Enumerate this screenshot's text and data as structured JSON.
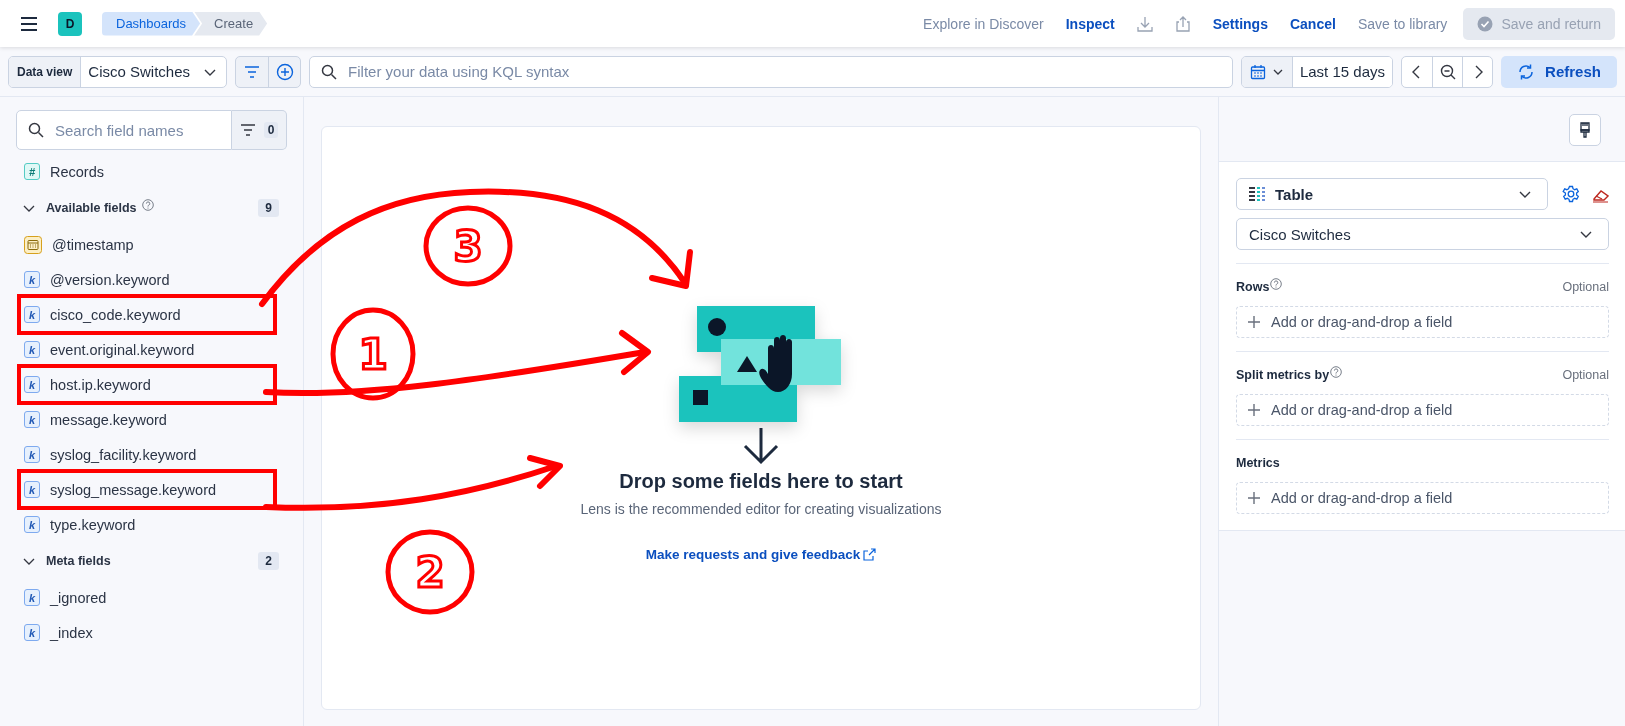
{
  "header": {
    "logo": "D",
    "breadcrumbs": [
      {
        "label": "Dashboards",
        "current": false
      },
      {
        "label": "Create",
        "current": true
      }
    ],
    "actions": [
      {
        "kind": "link",
        "label": "Explore in Discover",
        "disabled": true
      },
      {
        "kind": "link",
        "label": "Inspect",
        "disabled": false
      },
      {
        "kind": "download",
        "disabled": true
      },
      {
        "kind": "share",
        "disabled": true
      },
      {
        "kind": "link",
        "label": "Settings",
        "disabled": false
      },
      {
        "kind": "link",
        "label": "Cancel",
        "disabled": false
      },
      {
        "kind": "link",
        "label": "Save to library",
        "disabled": true
      },
      {
        "kind": "button",
        "label": "Save and return",
        "disabled": true
      }
    ]
  },
  "query_bar": {
    "data_view": {
      "label": "Data view",
      "value": "Cisco Switches"
    },
    "query": {
      "placeholder": "Filter your data using KQL syntax"
    },
    "time": {
      "value": "Last 15 days"
    },
    "refresh": {
      "label": "Refresh"
    }
  },
  "sidebar": {
    "search": {
      "placeholder": "Search field names"
    },
    "filter_count": "0",
    "records": {
      "label": "Records",
      "glyph": "#"
    },
    "groups": [
      {
        "title": "Available fields",
        "count": "9",
        "expanded": true,
        "has_help": true,
        "fields": [
          {
            "name": "@timestamp",
            "kind": "date"
          },
          {
            "name": "@version.keyword",
            "kind": "keyword",
            "glyph": "k"
          },
          {
            "name": "cisco_code.keyword",
            "kind": "keyword",
            "glyph": "k"
          },
          {
            "name": "event.original.keyword",
            "kind": "keyword",
            "glyph": "k"
          },
          {
            "name": "host.ip.keyword",
            "kind": "keyword",
            "glyph": "k"
          },
          {
            "name": "message.keyword",
            "kind": "keyword",
            "glyph": "k"
          },
          {
            "name": "syslog_facility.keyword",
            "kind": "keyword",
            "glyph": "k"
          },
          {
            "name": "syslog_message.keyword",
            "kind": "keyword",
            "glyph": "k"
          },
          {
            "name": "type.keyword",
            "kind": "keyword",
            "glyph": "k"
          }
        ]
      },
      {
        "title": "Meta fields",
        "count": "2",
        "expanded": true,
        "fields": [
          {
            "name": "_ignored",
            "kind": "keyword",
            "glyph": "k"
          },
          {
            "name": "_index",
            "kind": "keyword",
            "glyph": "k"
          }
        ]
      }
    ]
  },
  "workspace": {
    "title": "Drop some fields here to start",
    "subtitle": "Lens is the recommended editor for creating visualizations",
    "link": "Make requests and give feedback"
  },
  "config_panel": {
    "chart_type": "Table",
    "data_view": "Cisco Switches",
    "sections": [
      {
        "title": "Rows",
        "has_help": true,
        "optional": "Optional",
        "add_label": "Add or drag-and-drop a field"
      },
      {
        "title": "Split metrics by",
        "has_help": true,
        "optional": "Optional",
        "add_label": "Add or drag-and-drop a field"
      },
      {
        "title": "Metrics",
        "add_label": "Add or drag-and-drop a field"
      }
    ]
  },
  "annotations": [
    {
      "number": "1"
    },
    {
      "number": "2"
    },
    {
      "number": "3"
    }
  ]
}
